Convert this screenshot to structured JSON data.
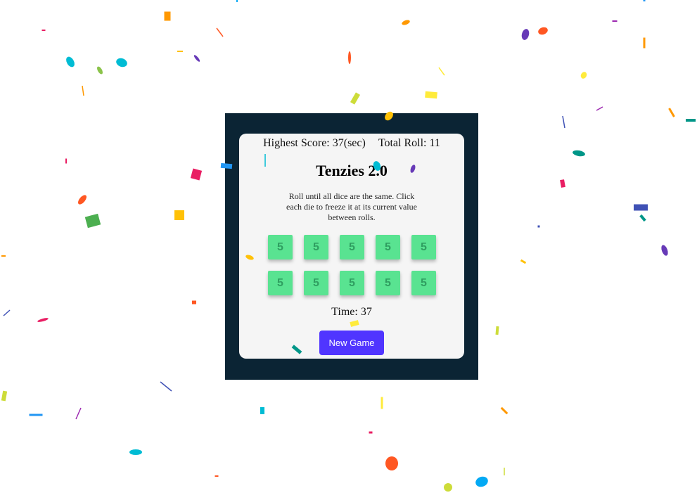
{
  "game": {
    "highest_score_label": "Highest Score: 37(sec)",
    "total_roll_label": "Total Roll: 11",
    "title": "Tenzies 2.0",
    "instructions": "Roll until all dice are the same. Click each die to freeze it at its current value between rolls.",
    "time_label": "Time: 37",
    "new_game_label": "New Game",
    "dice": [
      {
        "value": "5",
        "held": true
      },
      {
        "value": "5",
        "held": true
      },
      {
        "value": "5",
        "held": true
      },
      {
        "value": "5",
        "held": true
      },
      {
        "value": "5",
        "held": true
      },
      {
        "value": "5",
        "held": true
      },
      {
        "value": "5",
        "held": true
      },
      {
        "value": "5",
        "held": true
      },
      {
        "value": "5",
        "held": true
      },
      {
        "value": "5",
        "held": true
      }
    ]
  },
  "colors": {
    "frame": "#0b2434",
    "card": "#f5f5f5",
    "die_held": "#59e391",
    "button": "#5035ff",
    "confetti_palette": [
      "#ff9800",
      "#00bcd4",
      "#8bc34a",
      "#e91e63",
      "#673ab7",
      "#ff5722",
      "#2196f3",
      "#ffeb3b",
      "#cddc39",
      "#4caf50",
      "#009688",
      "#ffc107",
      "#3f51b5",
      "#9c27b0",
      "#03a9f4"
    ]
  }
}
